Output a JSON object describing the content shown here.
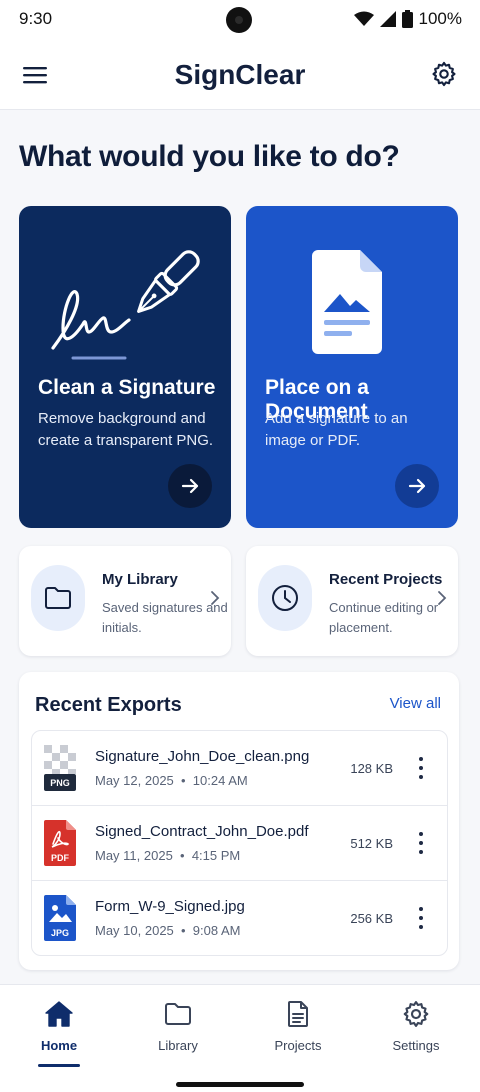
{
  "status_bar": {
    "time": "9:30",
    "battery": "100%"
  },
  "app_bar": {
    "title": "SignClear",
    "menu_icon": "hamburger-menu-icon",
    "settings_icon": "gear-icon"
  },
  "page": {
    "heading": "What would you like to do?"
  },
  "actions": [
    {
      "title": "Clean a Signature",
      "description": "Remove background and create a transparent PNG.",
      "icon": "pen-signature-icon",
      "color": "#0c2a5e"
    },
    {
      "title": "Place on a Document",
      "description": "Add a signature to an image or PDF.",
      "icon": "document-image-icon",
      "color": "#1c55c9"
    }
  ],
  "shortcuts": [
    {
      "title": "My Library",
      "description": "Saved signatures and initials.",
      "icon": "folder-icon"
    },
    {
      "title": "Recent Projects",
      "description": "Continue editing or placement.",
      "icon": "clock-icon"
    }
  ],
  "recent_exports": {
    "title": "Recent Exports",
    "view_all": "View all",
    "items": [
      {
        "name": "Signature_John_Doe_clean.png",
        "date": "May 12, 2025",
        "time": "10:24 AM",
        "size": "128 KB",
        "type": "PNG"
      },
      {
        "name": "Signed_Contract_John_Doe.pdf",
        "date": "May 11, 2025",
        "time": "4:15 PM",
        "size": "512 KB",
        "type": "PDF"
      },
      {
        "name": "Form_W-9_Signed.jpg",
        "date": "May 10, 2025",
        "time": "9:08 AM",
        "size": "256 KB",
        "type": "JPG"
      }
    ]
  },
  "bottom_nav": [
    {
      "label": "Home",
      "icon": "home-icon",
      "active": true
    },
    {
      "label": "Library",
      "icon": "folder-icon",
      "active": false
    },
    {
      "label": "Projects",
      "icon": "document-icon",
      "active": false
    },
    {
      "label": "Settings",
      "icon": "gear-icon",
      "active": false
    }
  ],
  "colors": {
    "primary_dark": "#0c2a5e",
    "primary": "#1c55c9",
    "accent_pdf": "#d6322b"
  }
}
